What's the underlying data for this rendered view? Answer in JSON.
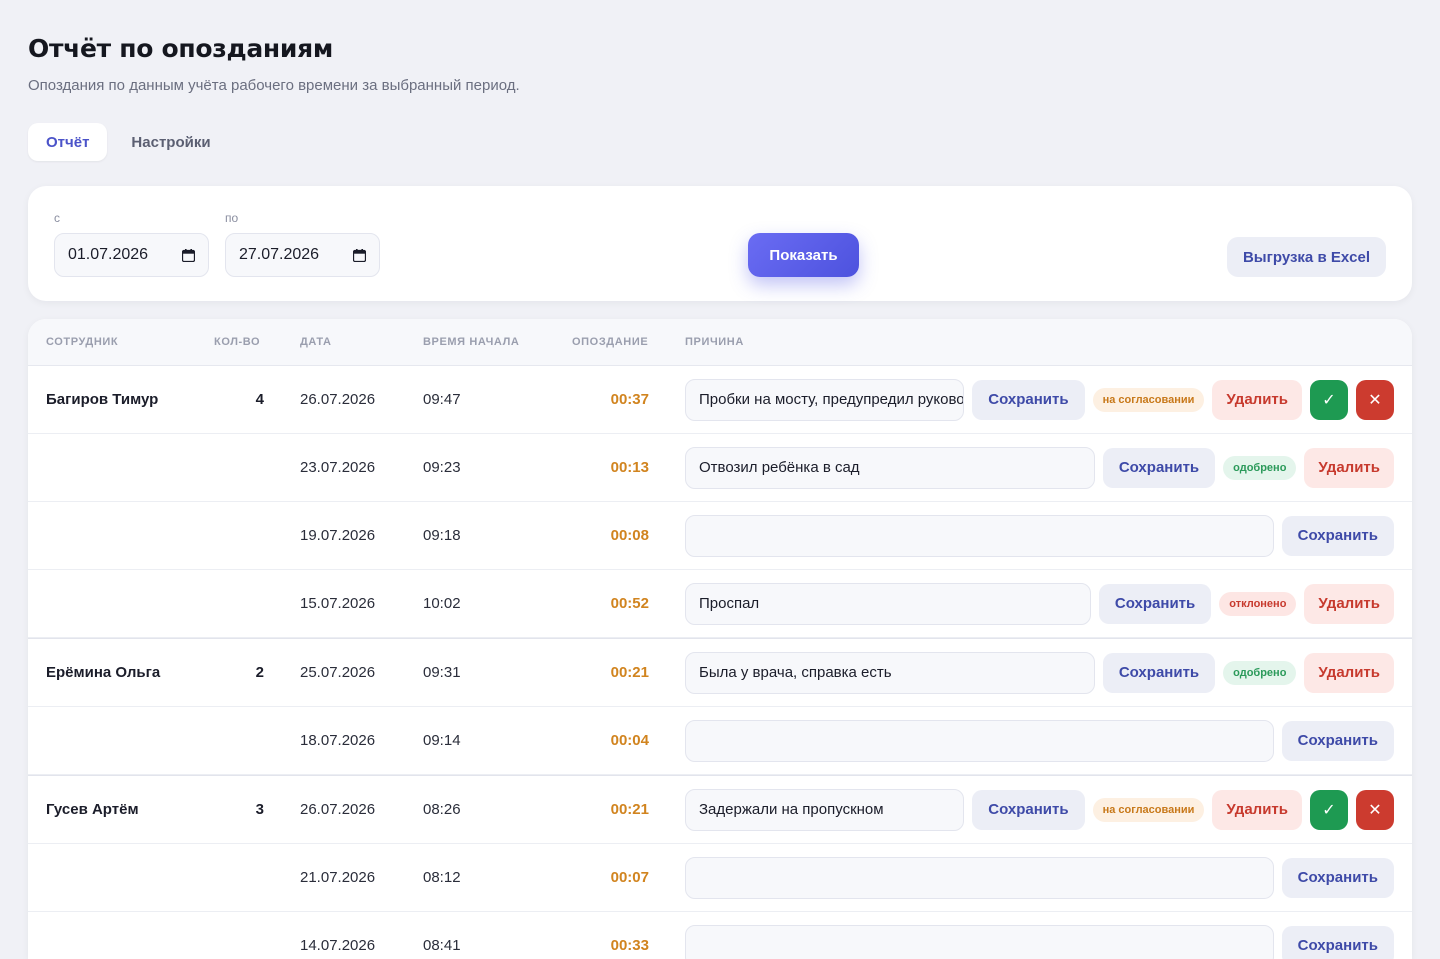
{
  "header": {
    "title": "Отчёт по опозданиям",
    "subtitle": "Опоздания по данным учёта рабочего времени за выбранный период."
  },
  "tabs": [
    {
      "label": "Отчёт",
      "active": true
    },
    {
      "label": "Настройки",
      "active": false
    }
  ],
  "filter": {
    "from_label": "с",
    "from_value": "01.07.2026",
    "to_label": "по",
    "to_value": "27.07.2026",
    "show_label": "Показать",
    "excel_label": "Выгрузка в Excel"
  },
  "table": {
    "headers": {
      "employee": "СОТРУДНИК",
      "count": "КОЛ-ВО",
      "date": "ДАТА",
      "start_time": "ВРЕМЯ НАЧАЛА",
      "late": "ОПОЗДАНИЕ",
      "reason": "ПРИЧИНА"
    },
    "save_label": "Сохранить",
    "delete_label": "Удалить",
    "approve_glyph": "✓",
    "reject_glyph": "✕",
    "status_labels": {
      "pending": "на согласовании",
      "approved": "одобрено",
      "rejected": "отклонено"
    },
    "rows": [
      {
        "name": "Багиров Тимур",
        "count": "4",
        "date": "26.07.2026",
        "time": "09:47",
        "late": "00:37",
        "reason": "Пробки на мосту, предупредил руководителя",
        "status": "pending",
        "group_start": true
      },
      {
        "name": "",
        "count": "",
        "date": "23.07.2026",
        "time": "09:23",
        "late": "00:13",
        "reason": "Отвозил ребёнка в сад",
        "status": "approved"
      },
      {
        "name": "",
        "count": "",
        "date": "19.07.2026",
        "time": "09:18",
        "late": "00:08",
        "reason": "",
        "status": ""
      },
      {
        "name": "",
        "count": "",
        "date": "15.07.2026",
        "time": "10:02",
        "late": "00:52",
        "reason": "Проспал",
        "status": "rejected"
      },
      {
        "name": "Ерёмина Ольга",
        "count": "2",
        "date": "25.07.2026",
        "time": "09:31",
        "late": "00:21",
        "reason": "Была у врача, справка есть",
        "status": "approved",
        "group_start": true
      },
      {
        "name": "",
        "count": "",
        "date": "18.07.2026",
        "time": "09:14",
        "late": "00:04",
        "reason": "",
        "status": ""
      },
      {
        "name": "Гусев Артём",
        "count": "3",
        "date": "26.07.2026",
        "time": "08:26",
        "late": "00:21",
        "reason": "Задержали на пропускном",
        "status": "pending",
        "group_start": true
      },
      {
        "name": "",
        "count": "",
        "date": "21.07.2026",
        "time": "08:12",
        "late": "00:07",
        "reason": "",
        "status": ""
      },
      {
        "name": "",
        "count": "",
        "date": "14.07.2026",
        "time": "08:41",
        "late": "00:33",
        "reason": "",
        "status": ""
      }
    ]
  }
}
